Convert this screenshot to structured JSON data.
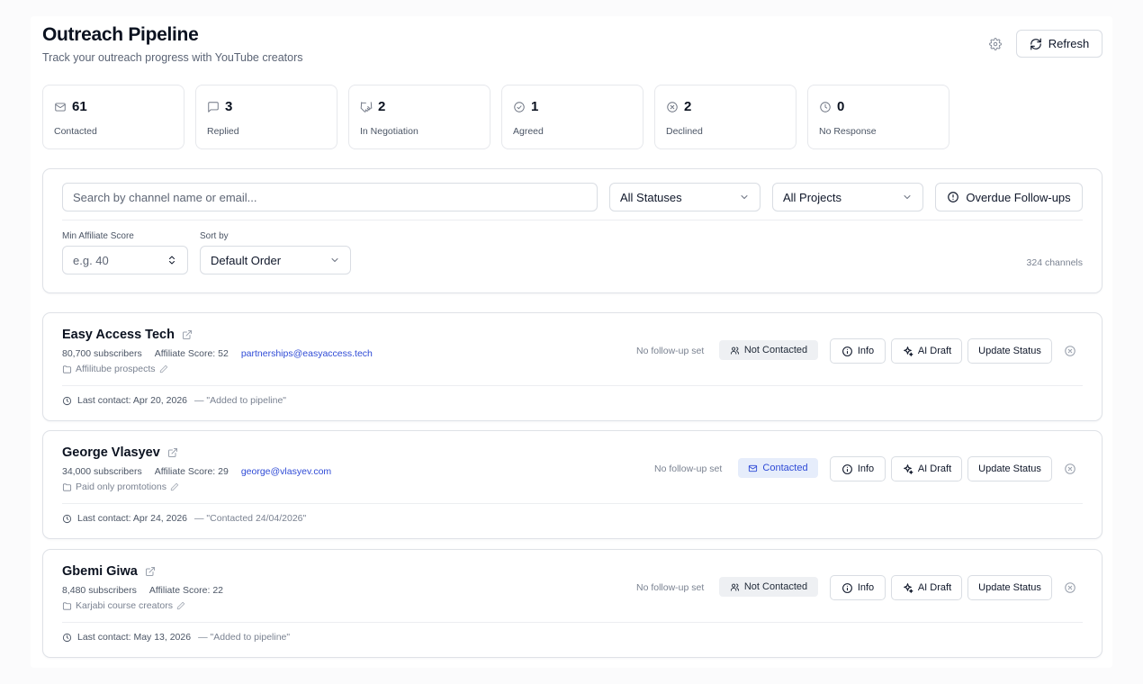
{
  "header": {
    "title": "Outreach Pipeline",
    "subtitle": "Track your outreach progress with YouTube creators",
    "refresh_label": "Refresh"
  },
  "stats": [
    {
      "icon": "mail-icon",
      "value": "61",
      "label": "Contacted"
    },
    {
      "icon": "message-icon",
      "value": "3",
      "label": "Replied"
    },
    {
      "icon": "handshake-icon",
      "value": "2",
      "label": "In Negotiation"
    },
    {
      "icon": "check-circle-icon",
      "value": "1",
      "label": "Agreed"
    },
    {
      "icon": "x-circle-icon",
      "value": "2",
      "label": "Declined"
    },
    {
      "icon": "clock-icon",
      "value": "0",
      "label": "No Response"
    }
  ],
  "filters": {
    "search_placeholder": "Search by channel name or email...",
    "status_select": "All Statuses",
    "project_select": "All Projects",
    "overdue_label": "Overdue Follow-ups",
    "min_score_label": "Min Affiliate Score",
    "min_score_placeholder": "e.g. 40",
    "sort_label": "Sort by",
    "sort_select": "Default Order",
    "channel_count": "324 channels"
  },
  "channels": [
    {
      "name": "Easy Access Tech",
      "subscribers": "80,700 subscribers",
      "score": "Affiliate Score: 52",
      "email": "partnerships@easyaccess.tech",
      "project": "Affilitube prospects",
      "last_contact": "Last contact: Apr 20, 2026",
      "note": "— \"Added to pipeline\"",
      "followup": "No follow-up set",
      "status": "Not Contacted"
    },
    {
      "name": "George Vlasyev",
      "subscribers": "34,000 subscribers",
      "score": "Affiliate Score: 29",
      "email": "george@vlasyev.com",
      "project": "Paid only promtotions",
      "last_contact": "Last contact: Apr 24, 2026",
      "note": "— \"Contacted 24/04/2026\"",
      "followup": "No follow-up set",
      "status": "Contacted"
    },
    {
      "name": "Gbemi Giwa",
      "subscribers": "8,480 subscribers",
      "score": "Affiliate Score: 22",
      "email": "",
      "project": "Karjabi course creators",
      "last_contact": "Last contact: May 13, 2026",
      "note": "— \"Added to pipeline\"",
      "followup": "No follow-up set",
      "status": "Not Contacted"
    }
  ],
  "actions": {
    "info": "Info",
    "ai_draft": "AI Draft",
    "update_status": "Update Status"
  },
  "colors": {
    "accent": "#2f4bd6",
    "contacted_bg": "#e6edfb",
    "not_contacted_bg": "#eef0f3"
  }
}
